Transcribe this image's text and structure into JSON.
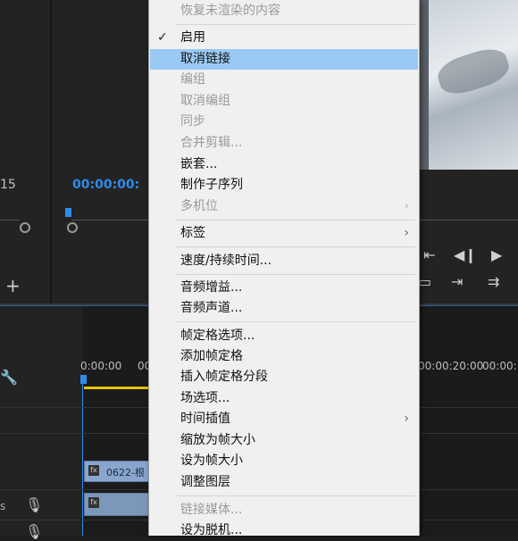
{
  "menu": {
    "top_item": "恢复未渲染的内容",
    "g1": [
      {
        "label": "启用",
        "checked": true,
        "disabled": false
      },
      {
        "label": "取消链接",
        "checked": false,
        "disabled": false,
        "highlighted": true
      },
      {
        "label": "编组",
        "disabled": true
      },
      {
        "label": "取消编组",
        "disabled": true
      },
      {
        "label": "同步",
        "disabled": true
      },
      {
        "label": "合并剪辑...",
        "disabled": true
      },
      {
        "label": "嵌套...",
        "disabled": false
      },
      {
        "label": "制作子序列",
        "disabled": false
      },
      {
        "label": "多机位",
        "disabled": true,
        "submenu": true
      }
    ],
    "g2": [
      {
        "label": "标签",
        "submenu": true
      }
    ],
    "g3": [
      {
        "label": "速度/持续时间..."
      }
    ],
    "g4": [
      {
        "label": "音频增益..."
      },
      {
        "label": "音频声道..."
      }
    ],
    "g5": [
      {
        "label": "帧定格选项..."
      },
      {
        "label": "添加帧定格"
      },
      {
        "label": "插入帧定格分段"
      },
      {
        "label": "场选项..."
      },
      {
        "label": "时间插值",
        "submenu": true
      },
      {
        "label": "缩放为帧大小"
      },
      {
        "label": "设为帧大小"
      },
      {
        "label": "调整图层"
      }
    ],
    "g6": [
      {
        "label": "链接媒体...",
        "disabled": true
      },
      {
        "label": "设为脱机..."
      }
    ]
  },
  "source": {
    "frame_num": "15",
    "timecode": "00:00:00:"
  },
  "timeline": {
    "ruler": [
      "0:00:00",
      "00",
      "00:00:20:00",
      "00:00:"
    ],
    "clip_name": "0622-根",
    "clip_fx": "fx",
    "track_label": "s"
  },
  "colors": {
    "accent": "#2d8ceb",
    "highlight": "#9ac9f3",
    "menu_bg": "#f0f0f0"
  }
}
